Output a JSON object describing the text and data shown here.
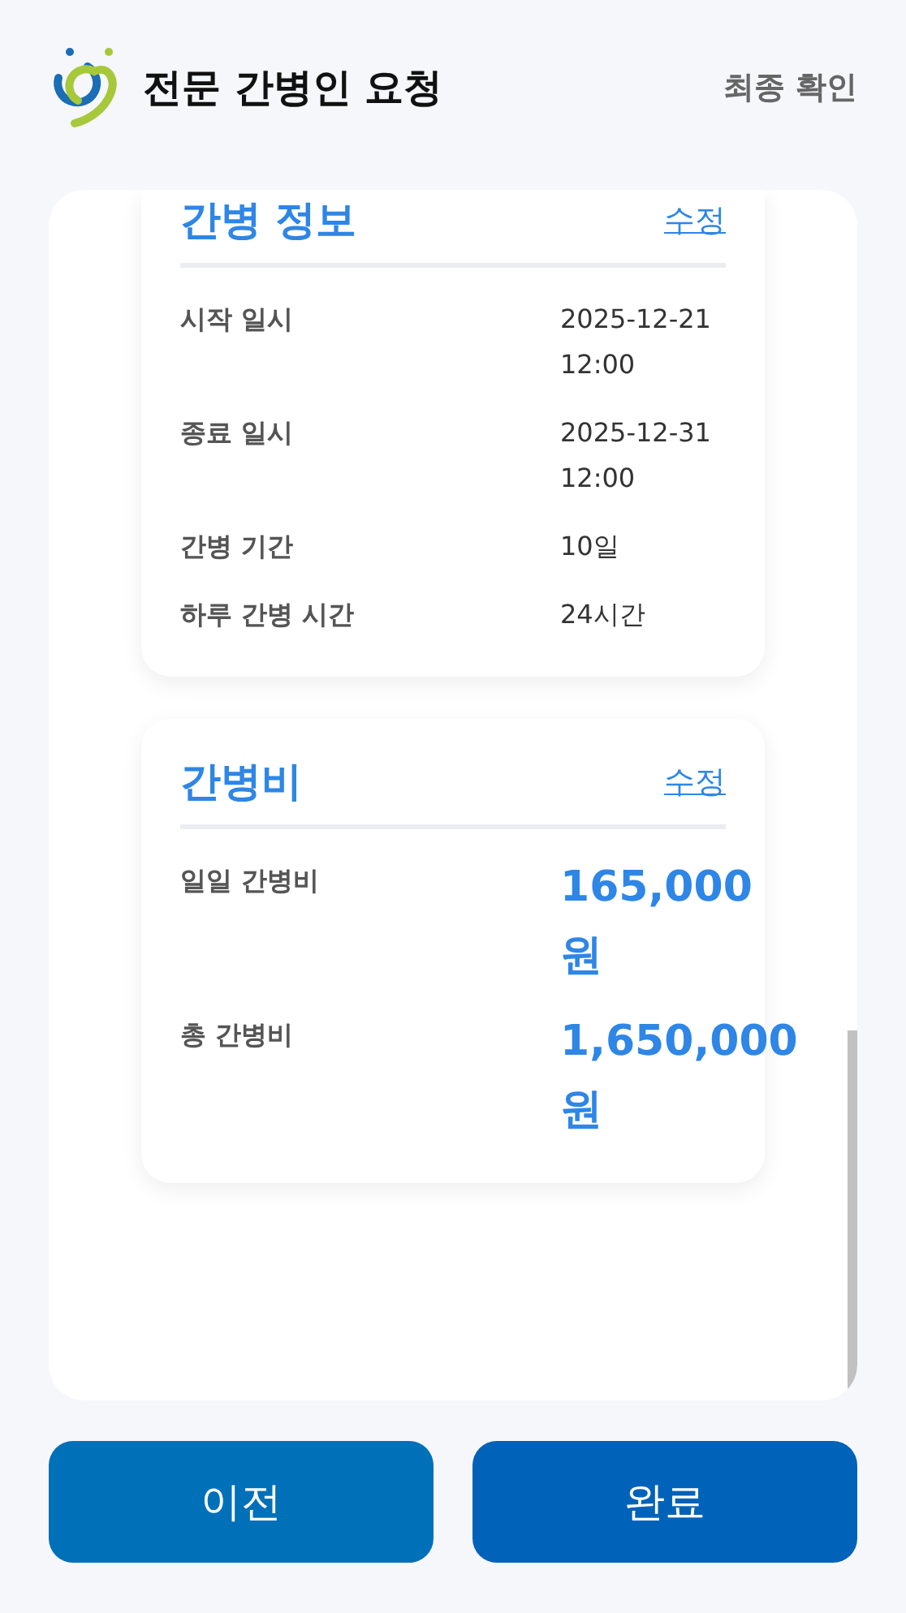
{
  "header": {
    "title": "전문 간병인 요청",
    "step": "최종 확인"
  },
  "sections": [
    {
      "title": "간병 정보",
      "edit": "수정",
      "rows": [
        {
          "kind": "plain",
          "label": "시작 일시",
          "value": "2025-12-21 12:00"
        },
        {
          "kind": "plain",
          "label": "종료 일시",
          "value": "2025-12-31 12:00"
        },
        {
          "kind": "plain",
          "label": "간병 기간",
          "value": "10일"
        },
        {
          "kind": "plain",
          "label": "하루 간병 시간",
          "value": "24시간"
        }
      ]
    },
    {
      "title": "간병비",
      "edit": "수정",
      "rows": [
        {
          "kind": "amount",
          "label": "일일 간병비",
          "value": "165,000 원"
        },
        {
          "kind": "amount",
          "label": "총 간병비",
          "value": "1,650,000 원"
        }
      ]
    }
  ],
  "buttons": [
    {
      "label": "이전",
      "kind": "prev"
    },
    {
      "label": "완료",
      "kind": "done"
    }
  ]
}
